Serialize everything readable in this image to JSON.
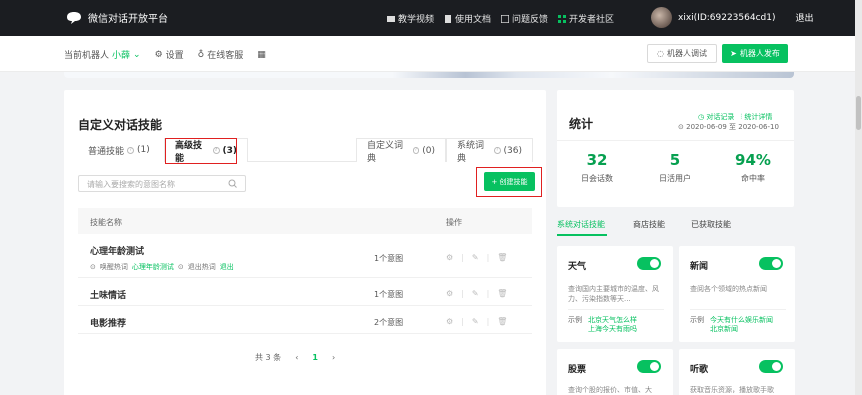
{
  "topbar": {
    "brand": "微信对话开放平台",
    "nav": [
      {
        "label": "教学视频",
        "icon": "play-icon"
      },
      {
        "label": "使用文档",
        "icon": "document-icon"
      },
      {
        "label": "问题反馈",
        "icon": "feedback-icon"
      },
      {
        "label": "开发者社区",
        "icon": "grid-icon"
      }
    ],
    "user": "xixi(ID:69223564cd1)",
    "logout": "退出"
  },
  "subbar": {
    "robot_label": "当前机器人",
    "robot_name": "小薛",
    "settings": "设置",
    "support": "在线客服",
    "btn_test": "机器人调试",
    "btn_publish": "机器人发布"
  },
  "skills": {
    "title": "自定义对话技能",
    "tabs": [
      {
        "label": "普通技能",
        "count": "(1)"
      },
      {
        "label": "高级技能",
        "count": "(3)"
      },
      {
        "label": "自定义词典",
        "count": "(0)"
      },
      {
        "label": "系统词典",
        "count": "(36)"
      }
    ],
    "search_placeholder": "请输入要搜索的意图名称",
    "create_btn": "+ 创建技能",
    "col_name": "技能名称",
    "col_ops": "操作",
    "rows": [
      {
        "name": "心理年龄测试",
        "intent": "1个意图",
        "wake_label": "唤醒热词",
        "wake_word": "心理年龄测试",
        "exit_label": "退出热词",
        "exit_word": "退出"
      },
      {
        "name": "土味情话",
        "intent": "1个意图"
      },
      {
        "name": "电影推荐",
        "intent": "2个意图"
      }
    ],
    "pager": {
      "total": "共 3 条",
      "prev": "‹",
      "current": "1",
      "next": "›"
    }
  },
  "stats": {
    "title": "统计",
    "link_records": "对话记录",
    "link_detail": "统计详情",
    "date_range": "2020-06-09 至 2020-06-10",
    "items": [
      {
        "num": "32",
        "label": "日会话数"
      },
      {
        "num": "5",
        "label": "日活用户"
      },
      {
        "num": "94%",
        "label": "命中率"
      }
    ]
  },
  "system": {
    "tabs": [
      "系统对话技能",
      "商店技能",
      "已获取技能"
    ],
    "cards": [
      {
        "title": "天气",
        "desc": "查询国内主要城市的温度、风力、污染指数等天...",
        "ex_label": "示例",
        "ex1": "北京天气怎么样",
        "ex2": "上海今天有雨吗"
      },
      {
        "title": "新闻",
        "desc": "查阅各个领域的热点新闻",
        "ex_label": "示例",
        "ex1": "今天有什么娱乐新闻",
        "ex2": "北京新闻"
      },
      {
        "title": "股票",
        "desc": "查询个股的报价、市值、大"
      },
      {
        "title": "听歌",
        "desc": "获取音乐资源，播放歌手歌"
      }
    ]
  },
  "colors": {
    "accent": "#07c160",
    "topbar": "#1b1d21",
    "highlight": "#e02020"
  }
}
